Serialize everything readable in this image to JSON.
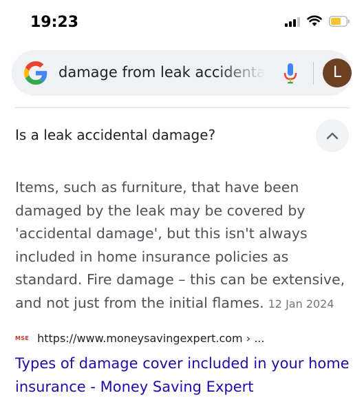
{
  "status_bar": {
    "time": "19:23",
    "icons": [
      "signal-icon",
      "wifi-icon",
      "battery-icon"
    ],
    "battery_color": "#f4c430"
  },
  "search": {
    "query": "damage from leak accidental...",
    "avatar_letter": "L",
    "avatar_color": "#6d3f23"
  },
  "faq": {
    "question": "Is a leak accidental damage?",
    "answer": "Items, such as furniture, that have been damaged by the leak may be covered by 'accidental damage', but this isn't always included in home insurance policies as standard. Fire damage – this can be extensive, and not just from the initial flames.",
    "date": "12 Jan 2024"
  },
  "source": {
    "favicon_text": "MSE",
    "url": "https://www.moneysavingexpert.com › ...",
    "title": "Types of damage cover included in your home insurance - Money Saving Expert",
    "link_color": "#1a0dab"
  }
}
